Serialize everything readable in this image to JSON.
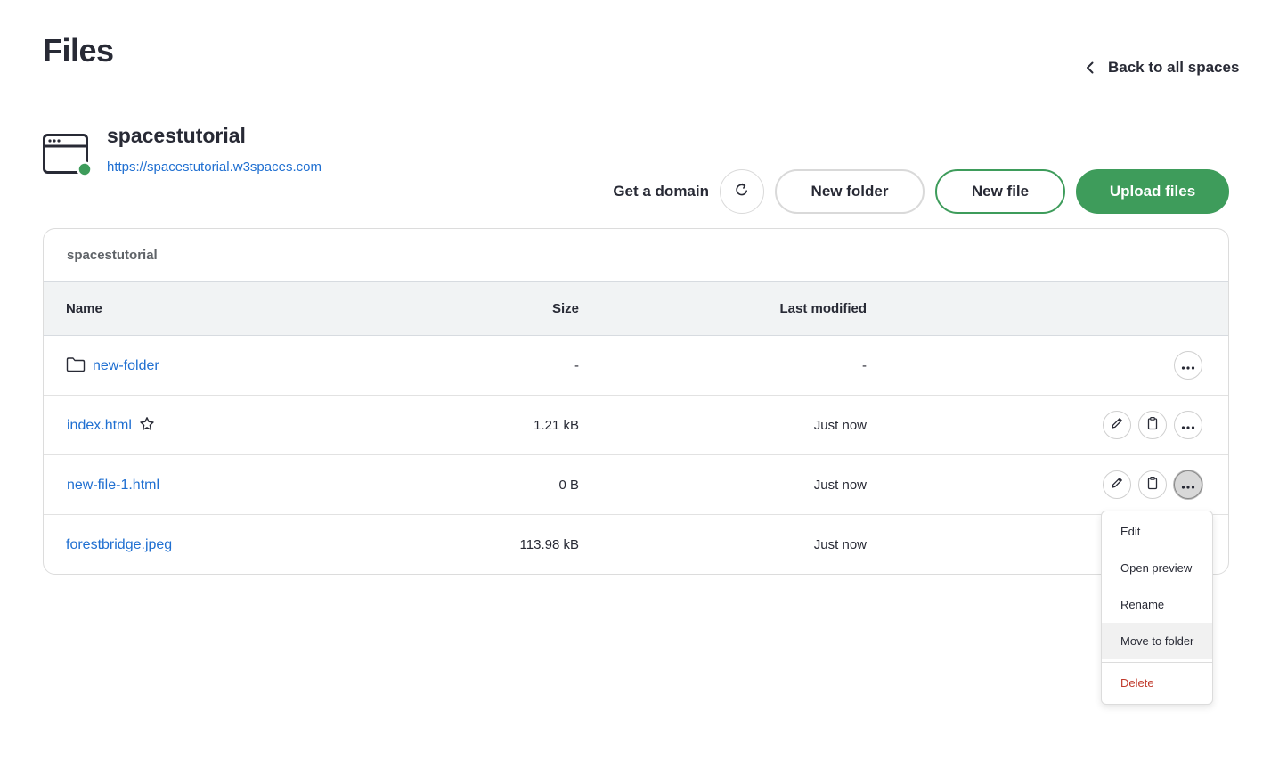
{
  "page": {
    "title": "Files"
  },
  "back_link": {
    "label": "Back to all spaces"
  },
  "space": {
    "name": "spacestutorial",
    "url": "https://spacestutorial.w3spaces.com",
    "status_color": "#3e9c5b"
  },
  "actions": {
    "get_domain": "Get a domain",
    "refresh_icon": "refresh-icon",
    "new_folder": "New folder",
    "new_file": "New file",
    "upload": "Upload files",
    "accent_color": "#3e9c5b"
  },
  "files": {
    "path": "spacestutorial",
    "columns": {
      "name": "Name",
      "size": "Size",
      "modified": "Last modified"
    },
    "rows": [
      {
        "name": "new-folder",
        "size": "-",
        "modified": "-",
        "type": "folder"
      },
      {
        "name": "index.html",
        "size": "1.21 kB",
        "modified": "Just now",
        "type": "file"
      },
      {
        "name": "new-file-1.html",
        "size": "0 B",
        "modified": "Just now",
        "type": "file"
      },
      {
        "name": "forestbridge.jpeg",
        "size": "113.98 kB",
        "modified": "Just now",
        "type": "image"
      }
    ]
  },
  "context_menu": {
    "items": [
      "Edit",
      "Open preview",
      "Rename",
      "Move to folder"
    ],
    "delete": "Delete",
    "delete_color": "#c0392b"
  }
}
